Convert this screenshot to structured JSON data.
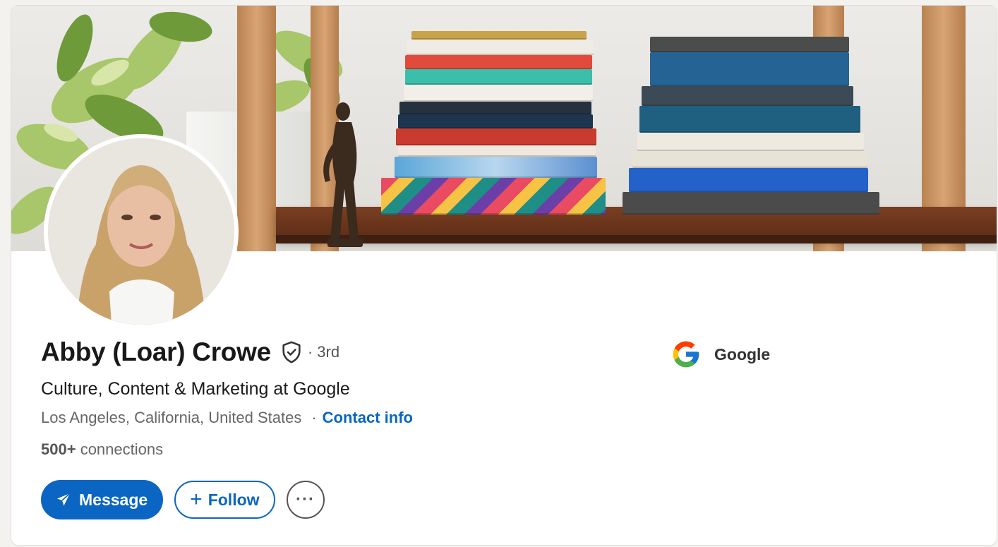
{
  "profile": {
    "name": "Abby (Loar) Crowe",
    "degree": "· 3rd",
    "headline": "Culture, Content & Marketing at Google",
    "location": "Los Angeles, California, United States",
    "contact_label": "Contact info",
    "connections_count": "500+",
    "connections_label": "connections"
  },
  "actions": {
    "message_label": "Message",
    "follow_plus": "+",
    "follow_label": "Follow",
    "more_label": "···"
  },
  "company": {
    "name": "Google"
  },
  "icons": {
    "verify": "shield-check-icon",
    "message": "paper-plane-icon",
    "company": "google-logo"
  },
  "colors": {
    "accent": "#0a66c2",
    "text": "#191919",
    "muted": "#666666"
  }
}
